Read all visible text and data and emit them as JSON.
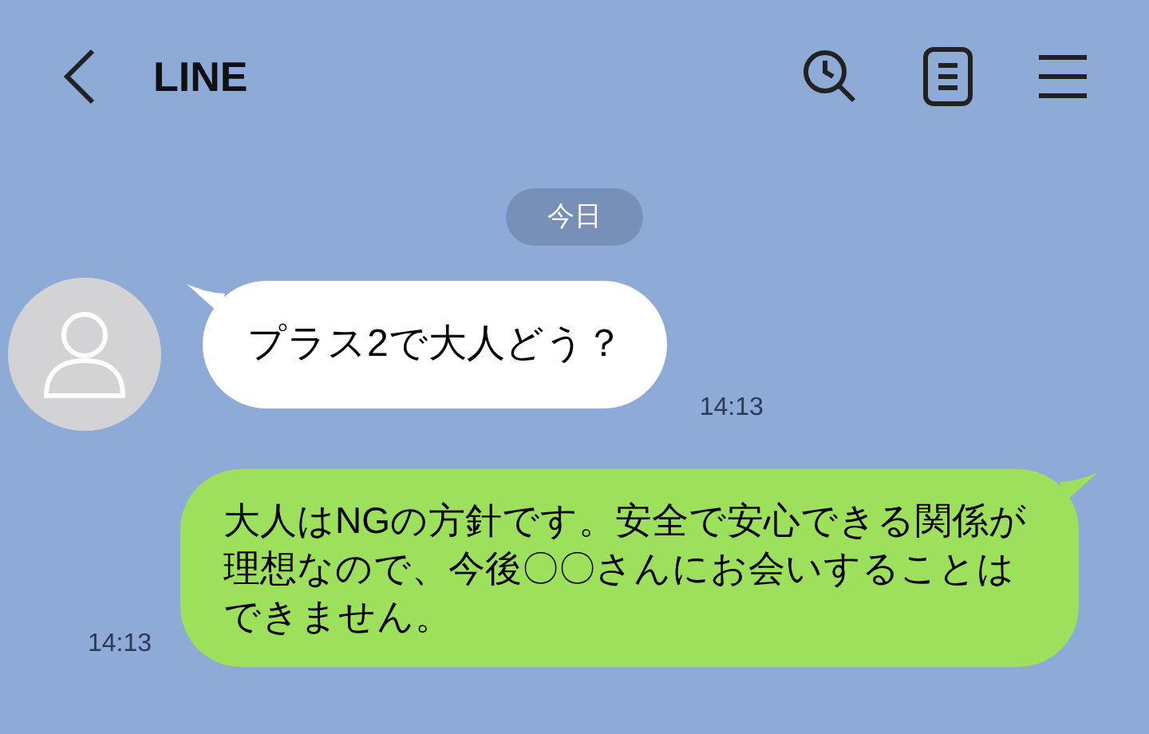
{
  "header": {
    "title": "LINE"
  },
  "date_label": "今日",
  "messages": [
    {
      "kind": "received",
      "text": "プラス2で大人どう？",
      "time": "14:13"
    },
    {
      "kind": "sent",
      "text": "大人はNGの方針です。安全で安心できる関係が理想なので、今後〇〇さんにお会いすることはできません。",
      "time": "14:13"
    }
  ]
}
